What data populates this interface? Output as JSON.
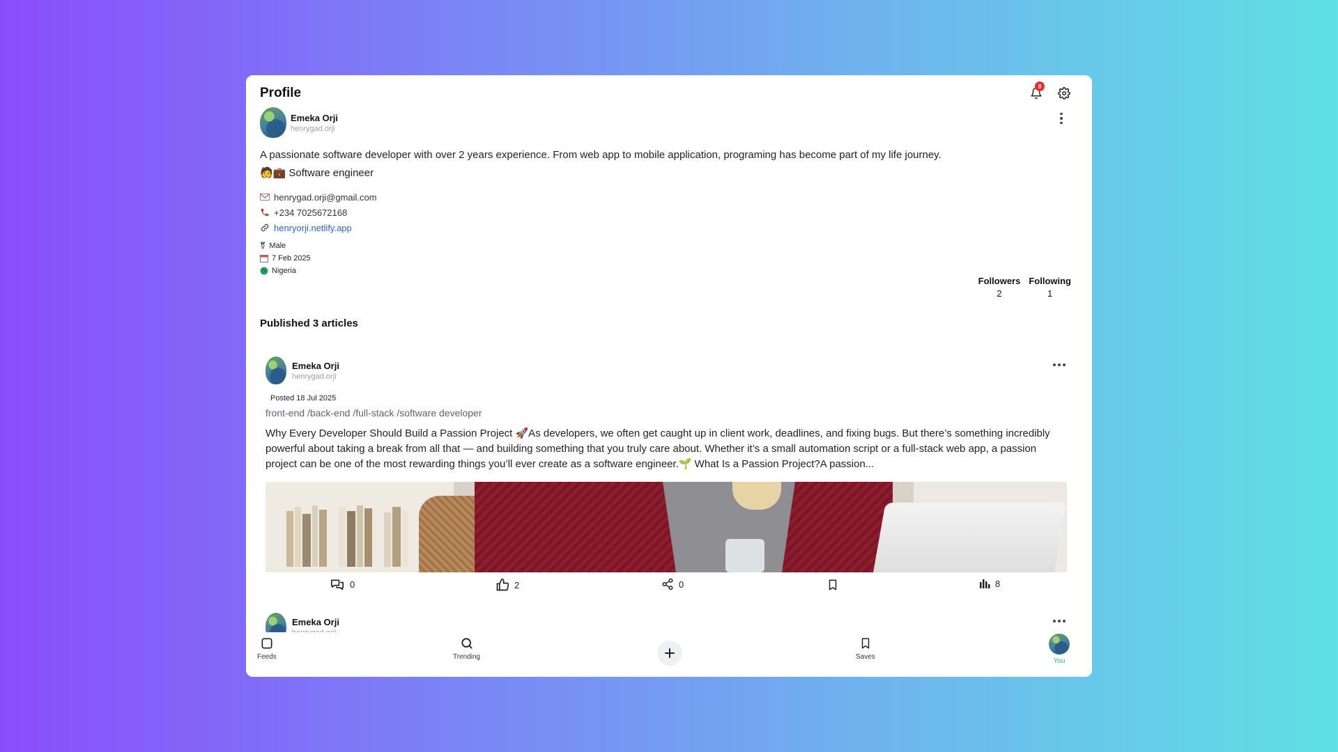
{
  "header": {
    "title": "Profile",
    "notification_count": "9"
  },
  "profile": {
    "name": "Emeka Orji",
    "handle": "henrygad.orji",
    "bio": "A passionate software developer with over 2 years experience. From web app to mobile application, programing has become part of my life journey.",
    "role": "Software engineer",
    "role_emojis": "🧑💼",
    "email": "henrygad.orji@gmail.com",
    "phone": "+234 7025672168",
    "website": "henryorji.netlify.app",
    "gender": "Male",
    "date": "7 Feb 2025",
    "country": "Nigeria",
    "followers_label": "Followers",
    "followers_count": "2",
    "following_label": "Following",
    "following_count": "1"
  },
  "published_heading": "Published 3 articles",
  "posts": [
    {
      "author_name": "Emeka Orji",
      "author_handle": "henrygad.orji",
      "posted": "Posted 18 Jul 2025",
      "tags": [
        "front-end",
        "/back-end",
        "/full-stack",
        "/software developer"
      ],
      "excerpt": "Why Every Developer Should Build a Passion Project 🚀As developers, we often get caught up in client work, deadlines, and fixing bugs. But there’s something incredibly powerful about taking a break from all that — and building something that you truly care about. Whether it’s a small automation script or a full-stack web app, a passion project can be one of the most rewarding things you’ll ever create as a software engineer.🌱 What Is a Passion Project?A passion...",
      "comments": "0",
      "likes": "2",
      "shares": "0",
      "views": "8"
    },
    {
      "author_name": "Emeka Orji",
      "author_handle": "henrygad.orji"
    }
  ],
  "nav": {
    "feeds": "Feeds",
    "trending": "Trending",
    "saves": "Saves",
    "you": "You"
  },
  "colors": {
    "link": "#2f62d0",
    "badge": "#e5312c",
    "active_nav": "#2bb3a4"
  }
}
